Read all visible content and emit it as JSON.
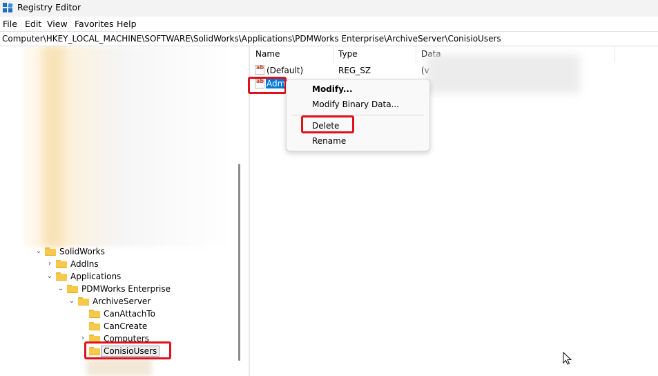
{
  "window": {
    "title": "Registry Editor",
    "icon": "registry-icon"
  },
  "menubar": {
    "items": [
      "File",
      "Edit",
      "View",
      "Favorites",
      "Help"
    ]
  },
  "address": {
    "path": "Computer\\HKEY_LOCAL_MACHINE\\SOFTWARE\\SolidWorks\\Applications\\PDMWorks Enterprise\\ArchiveServer\\ConisioUsers"
  },
  "tree": {
    "nodes": [
      {
        "label": "SolidWorks",
        "expander": "expanded"
      },
      {
        "label": "AddIns",
        "expander": "collapsed"
      },
      {
        "label": "Applications",
        "expander": "expanded"
      },
      {
        "label": "PDMWorks Enterprise",
        "expander": "expanded"
      },
      {
        "label": "ArchiveServer",
        "expander": "expanded"
      },
      {
        "label": "CanAttachTo",
        "expander": "none"
      },
      {
        "label": "CanCreate",
        "expander": "none"
      },
      {
        "label": "Computers",
        "expander": "collapsed"
      },
      {
        "label": "ConisioUsers",
        "expander": "none",
        "selected": true
      }
    ]
  },
  "values_list": {
    "columns": [
      "Name",
      "Type",
      "Data"
    ],
    "rows": [
      {
        "name": "(Default)",
        "type": "REG_SZ",
        "data": "(v"
      },
      {
        "name": "Adm",
        "selected": true
      }
    ]
  },
  "context_menu": {
    "items": [
      "Modify...",
      "Modify Binary Data...",
      "Delete",
      "Rename"
    ]
  },
  "colors": {
    "highlight": "#e0101c",
    "selection": "#0078d7",
    "folder": "#f7c948"
  }
}
